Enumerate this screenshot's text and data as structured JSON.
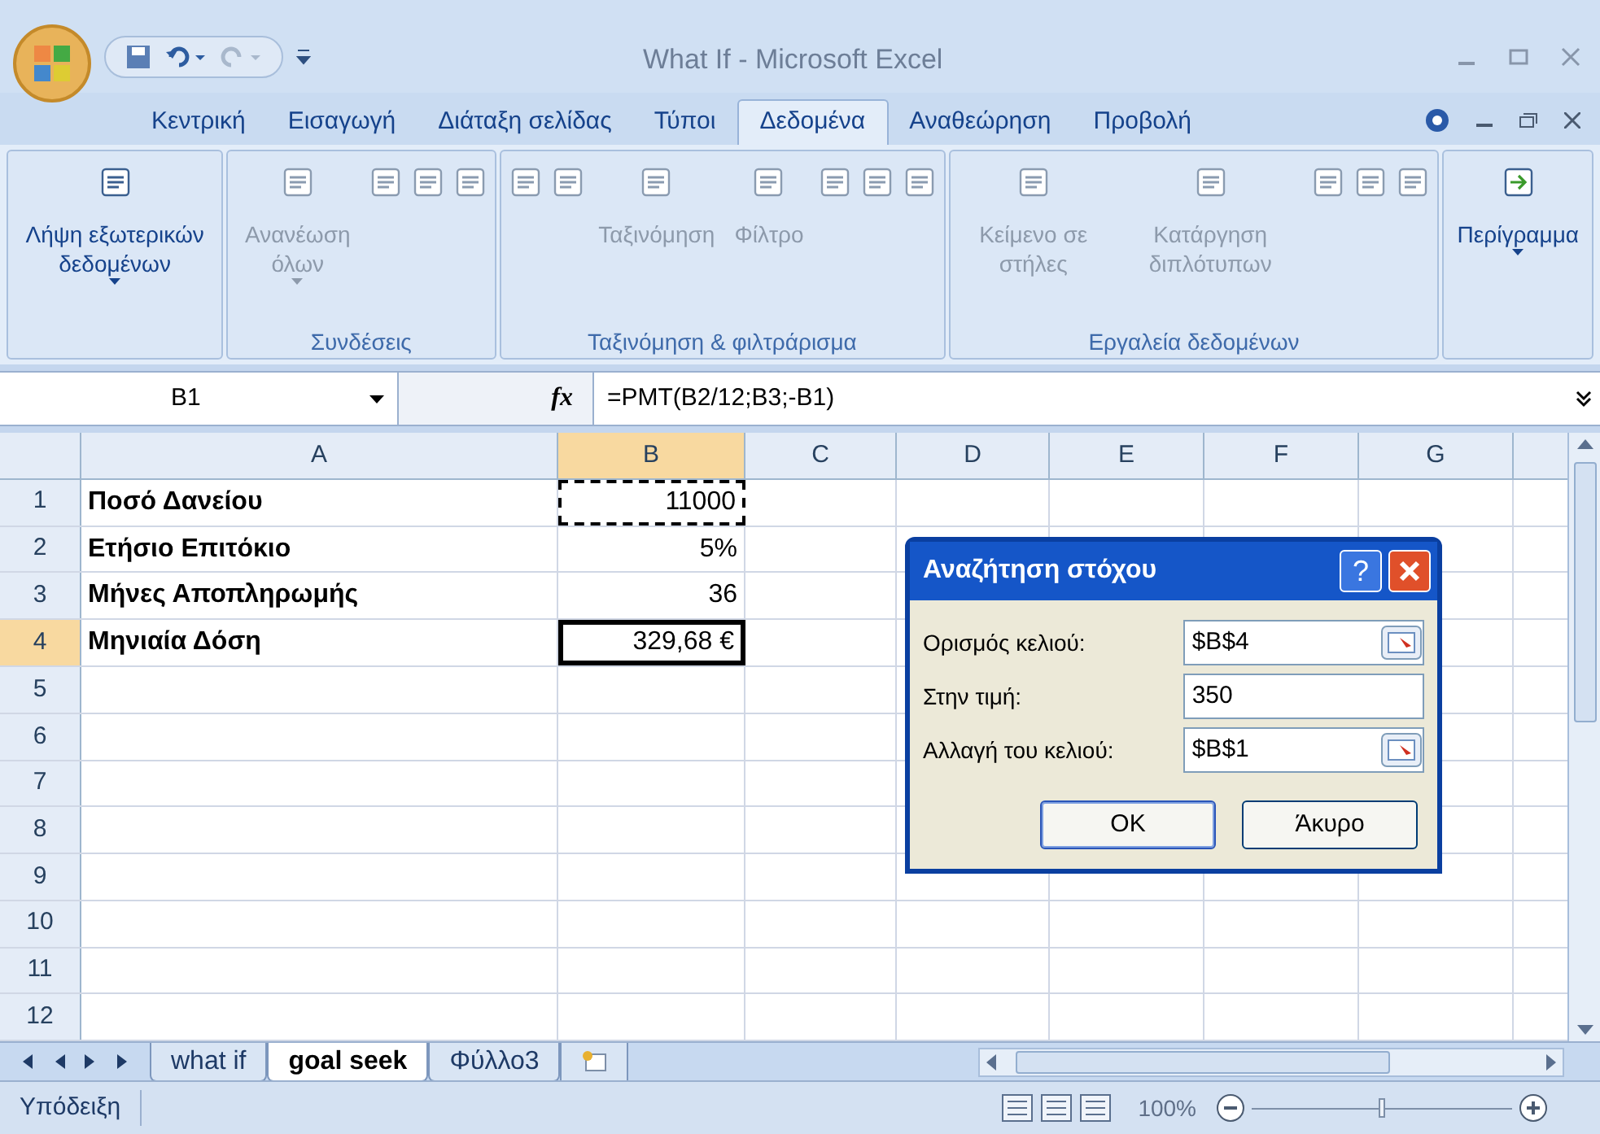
{
  "title_bar": {
    "title": "What If - Microsoft Excel"
  },
  "tabs": [
    {
      "label": "Κεντρική",
      "selected": false
    },
    {
      "label": "Εισαγωγή",
      "selected": false
    },
    {
      "label": "Διάταξη σελίδας",
      "selected": false
    },
    {
      "label": "Τύποι",
      "selected": false
    },
    {
      "label": "Δεδομένα",
      "selected": true
    },
    {
      "label": "Αναθεώρηση",
      "selected": false
    },
    {
      "label": "Προβολή",
      "selected": false
    }
  ],
  "ribbon": {
    "groups": [
      {
        "commands": [
          {
            "kind": "large",
            "label": "Λήψη εξωτερικών δεδομένων",
            "dropdown": true,
            "disabled": false
          }
        ]
      },
      {
        "label": "Συνδέσεις",
        "commands": [
          {
            "kind": "large",
            "label": "Ανανέωση όλων",
            "dropdown": true,
            "disabled": true
          },
          {
            "kind": "icon",
            "disabled": true
          },
          {
            "kind": "icon",
            "disabled": true
          },
          {
            "kind": "icon",
            "disabled": true
          }
        ]
      },
      {
        "label": "Ταξινόμηση & φιλτράρισμα",
        "commands": [
          {
            "kind": "icon",
            "disabled": true
          },
          {
            "kind": "icon",
            "disabled": true
          },
          {
            "kind": "large",
            "label": "Ταξινόμηση",
            "disabled": true
          },
          {
            "kind": "large",
            "label": "Φίλτρο",
            "disabled": true
          },
          {
            "kind": "icon",
            "disabled": true
          },
          {
            "kind": "icon",
            "disabled": true
          },
          {
            "kind": "icon",
            "disabled": true
          }
        ]
      },
      {
        "label": "Εργαλεία δεδομένων",
        "commands": [
          {
            "kind": "large",
            "label": "Κείμενο σε στήλες",
            "disabled": true
          },
          {
            "kind": "large",
            "label": "Κατάργηση διπλότυπων",
            "disabled": true
          },
          {
            "kind": "icon",
            "disabled": true
          },
          {
            "kind": "icon",
            "disabled": true
          },
          {
            "kind": "icon",
            "disabled": true
          }
        ]
      },
      {
        "commands": [
          {
            "kind": "large",
            "label": "Περίγραμμα",
            "dropdown": true,
            "disabled": false
          }
        ]
      }
    ]
  },
  "formula_bar": {
    "name_box": "B1",
    "function_label": "fx",
    "formula": "=PMT(B2/12;B3;-B1)"
  },
  "sheet": {
    "columns": [
      {
        "label": "A",
        "selected": false
      },
      {
        "label": "B",
        "selected": true
      },
      {
        "label": "C",
        "selected": false
      },
      {
        "label": "D",
        "selected": false
      },
      {
        "label": "E",
        "selected": false
      },
      {
        "label": "F",
        "selected": false
      },
      {
        "label": "G",
        "selected": false
      }
    ],
    "rows": [
      {
        "label": "1",
        "selected": false,
        "cells": [
          {
            "text": "Ποσό Δανείου"
          },
          {
            "text": "11000",
            "marquee": true,
            "active": false
          }
        ]
      },
      {
        "label": "2",
        "selected": false,
        "cells": [
          {
            "text": "Ετήσιο Επιτόκιο"
          },
          {
            "text": "5%",
            "marquee": false,
            "active": false
          }
        ]
      },
      {
        "label": "3",
        "selected": false,
        "cells": [
          {
            "text": "Μήνες Αποπληρωμής"
          },
          {
            "text": "36",
            "marquee": false,
            "active": false
          }
        ]
      },
      {
        "label": "4",
        "selected": true,
        "cells": [
          {
            "text": "Μηνιαία Δόση"
          },
          {
            "text": "329,68 €",
            "marquee": false,
            "active": true
          }
        ]
      },
      {
        "label": "5",
        "selected": false,
        "cells": []
      },
      {
        "label": "6",
        "selected": false,
        "cells": []
      },
      {
        "label": "7",
        "selected": false,
        "cells": []
      },
      {
        "label": "8",
        "selected": false,
        "cells": []
      },
      {
        "label": "9",
        "selected": false,
        "cells": []
      },
      {
        "label": "10",
        "selected": false,
        "cells": []
      },
      {
        "label": "11",
        "selected": false,
        "cells": []
      },
      {
        "label": "12",
        "selected": false,
        "cells": []
      }
    ]
  },
  "dialog": {
    "title": "Αναζήτηση στόχου",
    "help": "?",
    "fields": [
      {
        "label": "Ορισμός κελιού:",
        "value": "$B$4",
        "picker": true
      },
      {
        "label": "Στην τιμή:",
        "value": "350",
        "picker": false
      },
      {
        "label": "Αλλαγή του κελιού:",
        "value": "$B$1",
        "picker": true
      }
    ],
    "buttons": [
      {
        "label": "OK",
        "default": true
      },
      {
        "label": "Άκυρο",
        "default": false
      }
    ]
  },
  "sheet_tabs": [
    {
      "label": "what if",
      "selected": false
    },
    {
      "label": "goal seek",
      "selected": true
    },
    {
      "label": "Φύλλο3",
      "selected": false
    }
  ],
  "status_bar": {
    "text": "Υπόδειξη",
    "zoom": "100%",
    "zoom_slider": {
      "level": 0.5
    }
  }
}
